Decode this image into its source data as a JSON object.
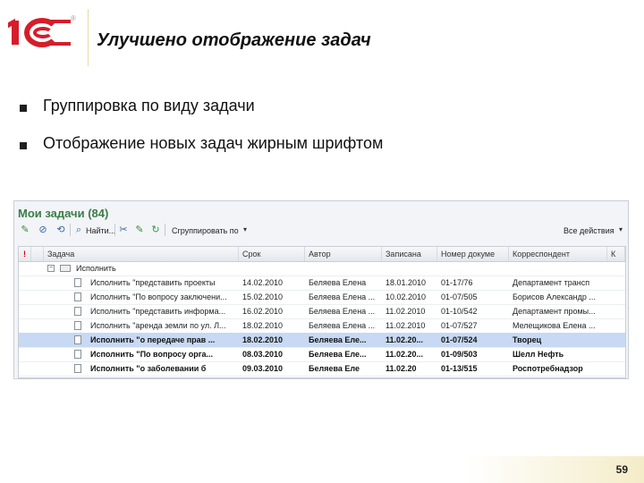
{
  "slide": {
    "title": "Улучшено отображение задач",
    "bullets": [
      "Группировка по виду задачи",
      "Отображение новых задач жирным шрифтом"
    ],
    "page_number": "59",
    "logo_mark": "®"
  },
  "app": {
    "title": "Мои задачи (84)",
    "toolbar": {
      "find_label": "Найти...",
      "group_label": "Сгруппировать по",
      "all_actions_label": "Все действия"
    },
    "columns": [
      "Задача",
      "Срок",
      "Автор",
      "Записана",
      "Номер докуме",
      "Корреспондент",
      "К"
    ],
    "group_row": "Исполнить",
    "rows": [
      {
        "task": "Исполнить \"представить проекты",
        "due": "14.02.2010",
        "author": "Беляева Елена",
        "recorded": "18.01.2010",
        "number": "01-17/76",
        "correspondent": "Департамент трансп",
        "bold": false,
        "selected": false
      },
      {
        "task": "Исполнить \"По вопросу заключени...",
        "due": "15.02.2010",
        "author": "Беляева Елена ...",
        "recorded": "10.02.2010",
        "number": "01-07/505",
        "correspondent": "Борисов Александр ...",
        "bold": false,
        "selected": false
      },
      {
        "task": "Исполнить \"представить информа...",
        "due": "16.02.2010",
        "author": "Беляева Елена ...",
        "recorded": "11.02.2010",
        "number": "01-10/542",
        "correspondent": "Департамент промы...",
        "bold": false,
        "selected": false
      },
      {
        "task": "Исполнить \"аренда земли по ул. Л...",
        "due": "18.02.2010",
        "author": "Беляева Елена ...",
        "recorded": "11.02.2010",
        "number": "01-07/527",
        "correspondent": "Мелещикова Елена ...",
        "bold": false,
        "selected": false
      },
      {
        "task": "Исполнить \"о передаче прав ...",
        "due": "18.02.2010",
        "author": "Беляева Еле...",
        "recorded": "11.02.20...",
        "number": "01-07/524",
        "correspondent": "Творец",
        "bold": true,
        "selected": true
      },
      {
        "task": "Исполнить \"По вопросу орга...",
        "due": "08.03.2010",
        "author": "Беляева Еле...",
        "recorded": "11.02.20...",
        "number": "01-09/503",
        "correspondent": "Шелл Нефть",
        "bold": true,
        "selected": false
      },
      {
        "task": "Исполнить \"о заболевании б",
        "due": "09.03.2010",
        "author": "Беляева Еле",
        "recorded": "11.02.20",
        "number": "01-13/515",
        "correspondent": "Роспотребнадзор",
        "bold": true,
        "selected": false
      }
    ]
  }
}
